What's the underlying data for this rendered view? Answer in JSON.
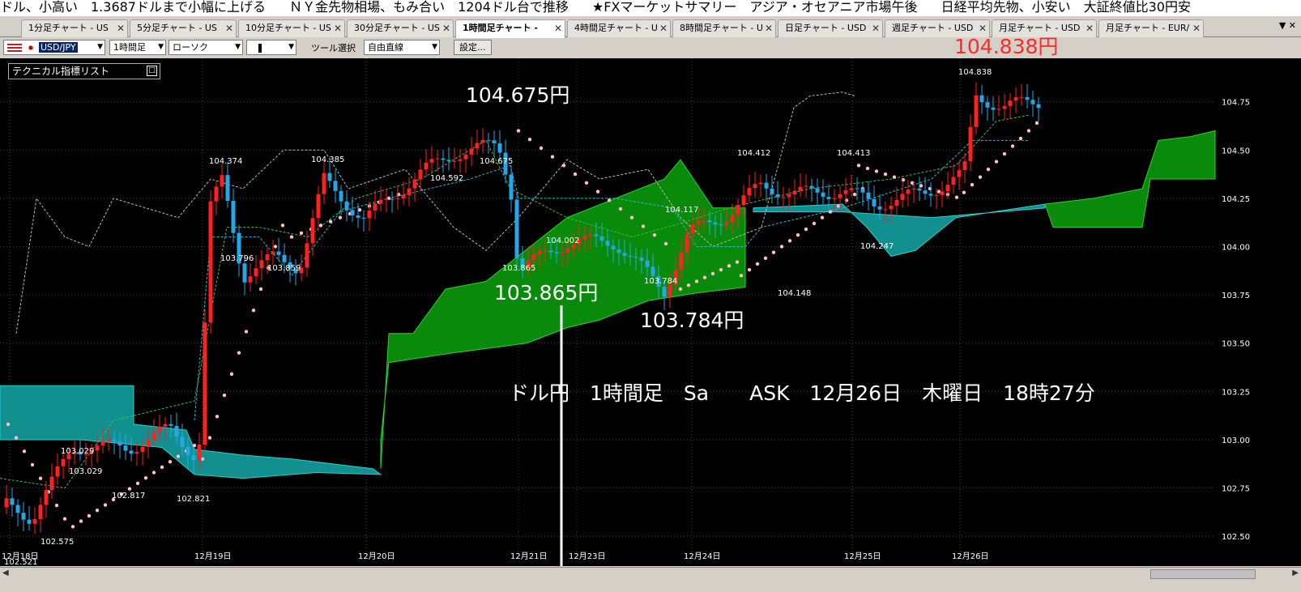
{
  "ticker": [
    "ドル、小高い　1.3687ドルまで小幅に上げる",
    "ＮＹ金先物相場、もみ合い　1204ドル台で推移",
    "★FXマーケットサマリー　アジア・オセアニア市場午後",
    "日経平均先物、小安い　大証終値比30円安"
  ],
  "tabs": [
    "1分足チャート - US",
    "5分足チャート - US",
    "10分足チャート - US",
    "30分足チャート - US",
    "1時間足チャート - ",
    "4時間足チャート - U",
    "8時間足チャート - U",
    "日足チャート - USD",
    "週足チャート - USD",
    "月足チャート - USD",
    "月足チャート - EUR/"
  ],
  "toolbar": {
    "pair": "USD/JPY",
    "period": "1時間足",
    "type": "ローソク",
    "tool_label": "ツール選択",
    "tool": "自由直線",
    "settings": "設定..."
  },
  "indicator_list": "テクニカル指標リスト",
  "header_price": "104.838円",
  "annotations": {
    "high": "104.675円",
    "low1": "103.865円",
    "low2": "103.784円",
    "caption": "ドル円　1時間足　Sa　　ASK　12月26日　木曜日　18時27分"
  },
  "colors": {
    "bull": "#ff2020",
    "bear": "#22a8e8",
    "cloud_green": "#0a8a0a",
    "cloud_teal": "#12908f",
    "psar": "#ffc0c8"
  },
  "chart_data": {
    "type": "line",
    "ylim": [
      102.375,
      104.975
    ],
    "y_ticks": [
      "104.75",
      "104.50",
      "104.25",
      "104.00",
      "103.75",
      "103.50",
      "103.25",
      "103.00",
      "102.75",
      "102.50"
    ],
    "x_labels": [
      "12月18日",
      "12月19日",
      "12月20日",
      "12月21日",
      "12月23日",
      "12月24日",
      "12月25日",
      "12月26日"
    ],
    "price_labels": [
      "102.521",
      "102.575",
      "103.029",
      "103.029",
      "102.817",
      "102.821",
      "104.374",
      "103.796",
      "103.859",
      "104.385",
      "104.592",
      "104.675",
      "103.865",
      "104.002",
      "104.117",
      "103.784",
      "104.412",
      "104.413",
      "104.247",
      "104.148",
      "104.838"
    ]
  }
}
